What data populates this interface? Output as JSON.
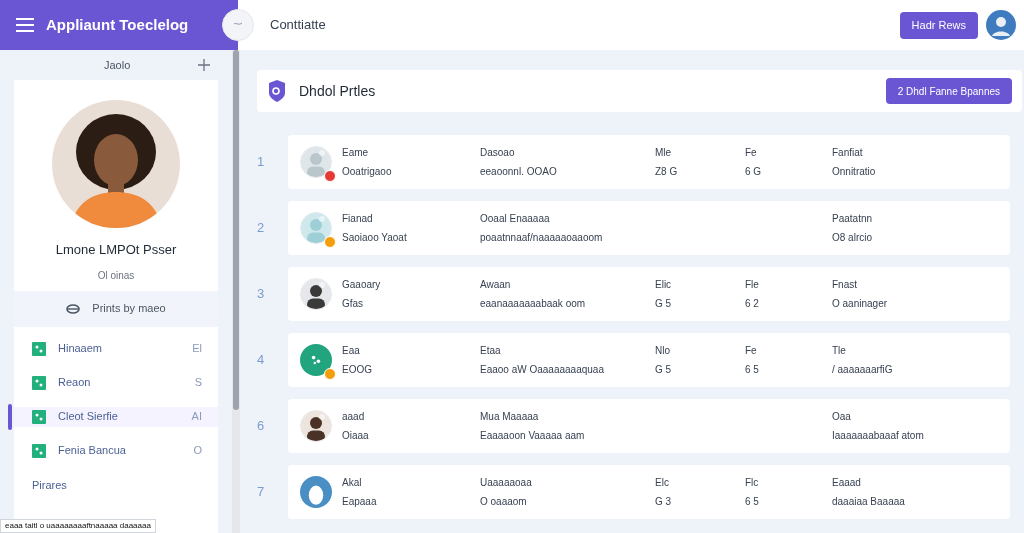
{
  "app_bar": {
    "title": "Appliaunt Toeclelog",
    "page_title": "Conttiatte",
    "action_button": "Hadr Rews"
  },
  "sidebar": {
    "heading": "Jaolo",
    "profile": {
      "name": "Lmone LMPOt Psser",
      "subtitle": "Ol oinas",
      "action": "Prints by maeo"
    },
    "items": [
      {
        "label": "Hinaaem",
        "trailing": "El",
        "selected": false
      },
      {
        "label": "Reaon",
        "trailing": "S",
        "selected": false
      },
      {
        "label": "Cleot Sierfie",
        "trailing": "AI",
        "selected": true
      },
      {
        "label": "Fenia Bancua",
        "trailing": "O",
        "selected": false
      }
    ],
    "section_label": "Pirares",
    "tooltip": "eaaa taitl o uaaaaaaaaftnaaaaa daaaaaa"
  },
  "panel": {
    "title": "Dhdol Prtles",
    "button": "2 Dhdl Fanne Bpannes"
  },
  "rows": [
    {
      "number": "1",
      "badge": {
        "color": "#e53935"
      },
      "name": "Eame",
      "subtitle": "Ooatrigaoo",
      "col_2": {
        "label": "Dasoao",
        "value": "eeaoonnl. OOAO"
      },
      "col_3": {
        "label": "Mle",
        "value": "Z8 G"
      },
      "col_4": {
        "label": "Fe",
        "value": "6 G"
      },
      "col_5": {
        "label": "Fanfiat",
        "value": "Onnitratio"
      }
    },
    {
      "number": "2",
      "badge": {
        "color": "#f59e0b"
      },
      "name": "Fianad",
      "subtitle": "Saoiaoo Yaoat",
      "col_2": {
        "label": "Ooaal Enaaaaa",
        "value": "poaatnnaaf/naaaaaoaaoom"
      },
      "col_5": {
        "label": "Paatatnn",
        "value": "O8 alrcio"
      }
    },
    {
      "number": "3",
      "name": "Gaaoary",
      "subtitle": "Gfas",
      "col_2": {
        "label": "Awaan",
        "value": "eaanaaaaaaabaak oom"
      },
      "col_3": {
        "label": "Elic",
        "value": "G 5"
      },
      "col_4": {
        "label": "Fle",
        "value": "6 2"
      },
      "col_5": {
        "label": "Fnast",
        "value": "O aaninager"
      }
    },
    {
      "number": "4",
      "avatar": {
        "kind": "glyph"
      },
      "badge": {
        "color": "#f59e0b"
      },
      "name": "Eaa",
      "subtitle": "EOOG",
      "col_2": {
        "label": "Etaa",
        "value": "Eaaoo aW Oaaaaaaaaquaa"
      },
      "col_3": {
        "label": "Nlo",
        "value": "G 5"
      },
      "col_4": {
        "label": "Fe",
        "value": "6 5"
      },
      "col_5": {
        "label": "Tle",
        "value": "/ aaaaaaarfiG"
      }
    },
    {
      "number": "6",
      "name": "aaad",
      "subtitle": "Oiaaa",
      "col_2": {
        "label": "Mua Maaaaa",
        "value": "Eaaaaoon Vaaaaa aam"
      },
      "col_5": {
        "label": "Oaa",
        "value": "Iaaaaaaabaaaf atom"
      }
    },
    {
      "number": "7",
      "avatar": {
        "kind": "silhouette"
      },
      "name": "Akal",
      "subtitle": "Eapaaa",
      "col_2": {
        "label": "Uaaaaaoaa",
        "value": "O oaaaom"
      },
      "col_3": {
        "label": "Elc",
        "value": "G 3"
      },
      "col_4": {
        "label": "Flc",
        "value": "6 5"
      },
      "col_5": {
        "label": "Eaaad",
        "value": "daaaiaa Baaaaa"
      }
    }
  ]
}
